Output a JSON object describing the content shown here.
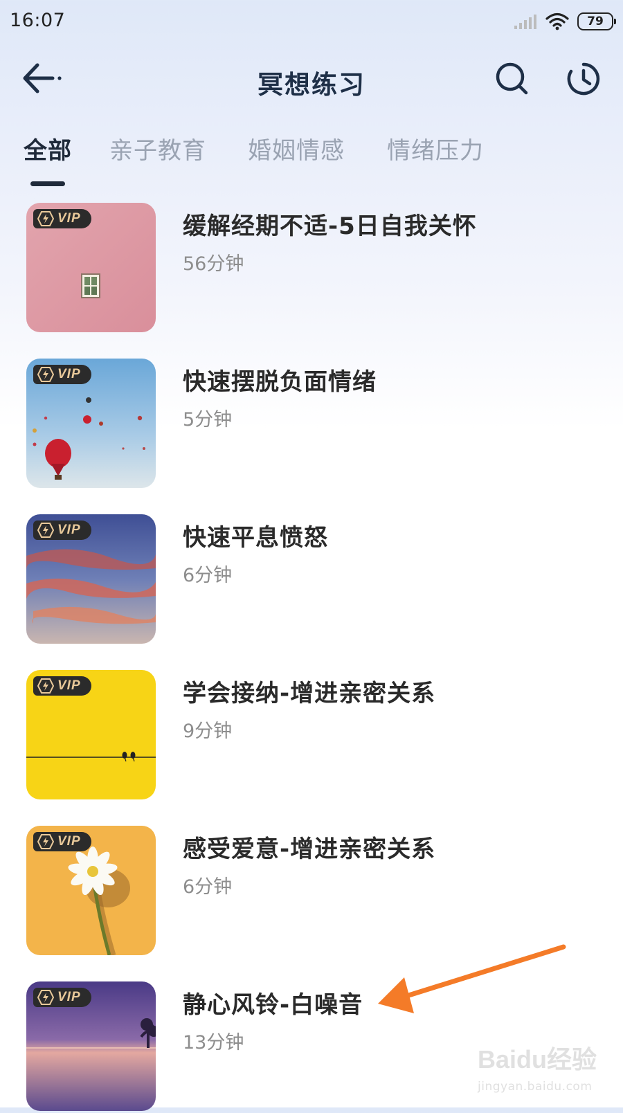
{
  "status_bar": {
    "time": "16:07",
    "battery_level": "79"
  },
  "nav": {
    "title": "冥想练习"
  },
  "tabs": [
    {
      "label": "全部",
      "active": true
    },
    {
      "label": "亲子教育",
      "active": false
    },
    {
      "label": "婚姻情感",
      "active": false
    },
    {
      "label": "情绪压力",
      "active": false
    }
  ],
  "items": [
    {
      "title": "缓解经期不适-5日自我关怀",
      "duration": "56分钟",
      "badge": "VIP",
      "thumbnail": "pink-wall-window"
    },
    {
      "title": "快速摆脱负面情绪",
      "duration": "5分钟",
      "badge": "VIP",
      "thumbnail": "hot-air-balloons"
    },
    {
      "title": "快速平息愤怒",
      "duration": "6分钟",
      "badge": "VIP",
      "thumbnail": "sunset-clouds"
    },
    {
      "title": "学会接纳-增进亲密关系",
      "duration": "9分钟",
      "badge": "VIP",
      "thumbnail": "yellow-birds-on-wire"
    },
    {
      "title": "感受爱意-增进亲密关系",
      "duration": "6分钟",
      "badge": "VIP",
      "thumbnail": "daisy-on-orange"
    },
    {
      "title": "静心风铃-白噪音",
      "duration": "13分钟",
      "badge": "VIP",
      "thumbnail": "purple-lake-sunset"
    }
  ],
  "annotation": {
    "arrow_color": "#f47b28"
  },
  "watermark": {
    "text": "Baidu经验",
    "url_text": "jingyan.baidu.com"
  },
  "colors": {
    "title": "#1e2f47",
    "tab_active": "#1f2a3a",
    "tab_inactive": "#9aa3b2",
    "vip_gold": "#e9c99a"
  }
}
